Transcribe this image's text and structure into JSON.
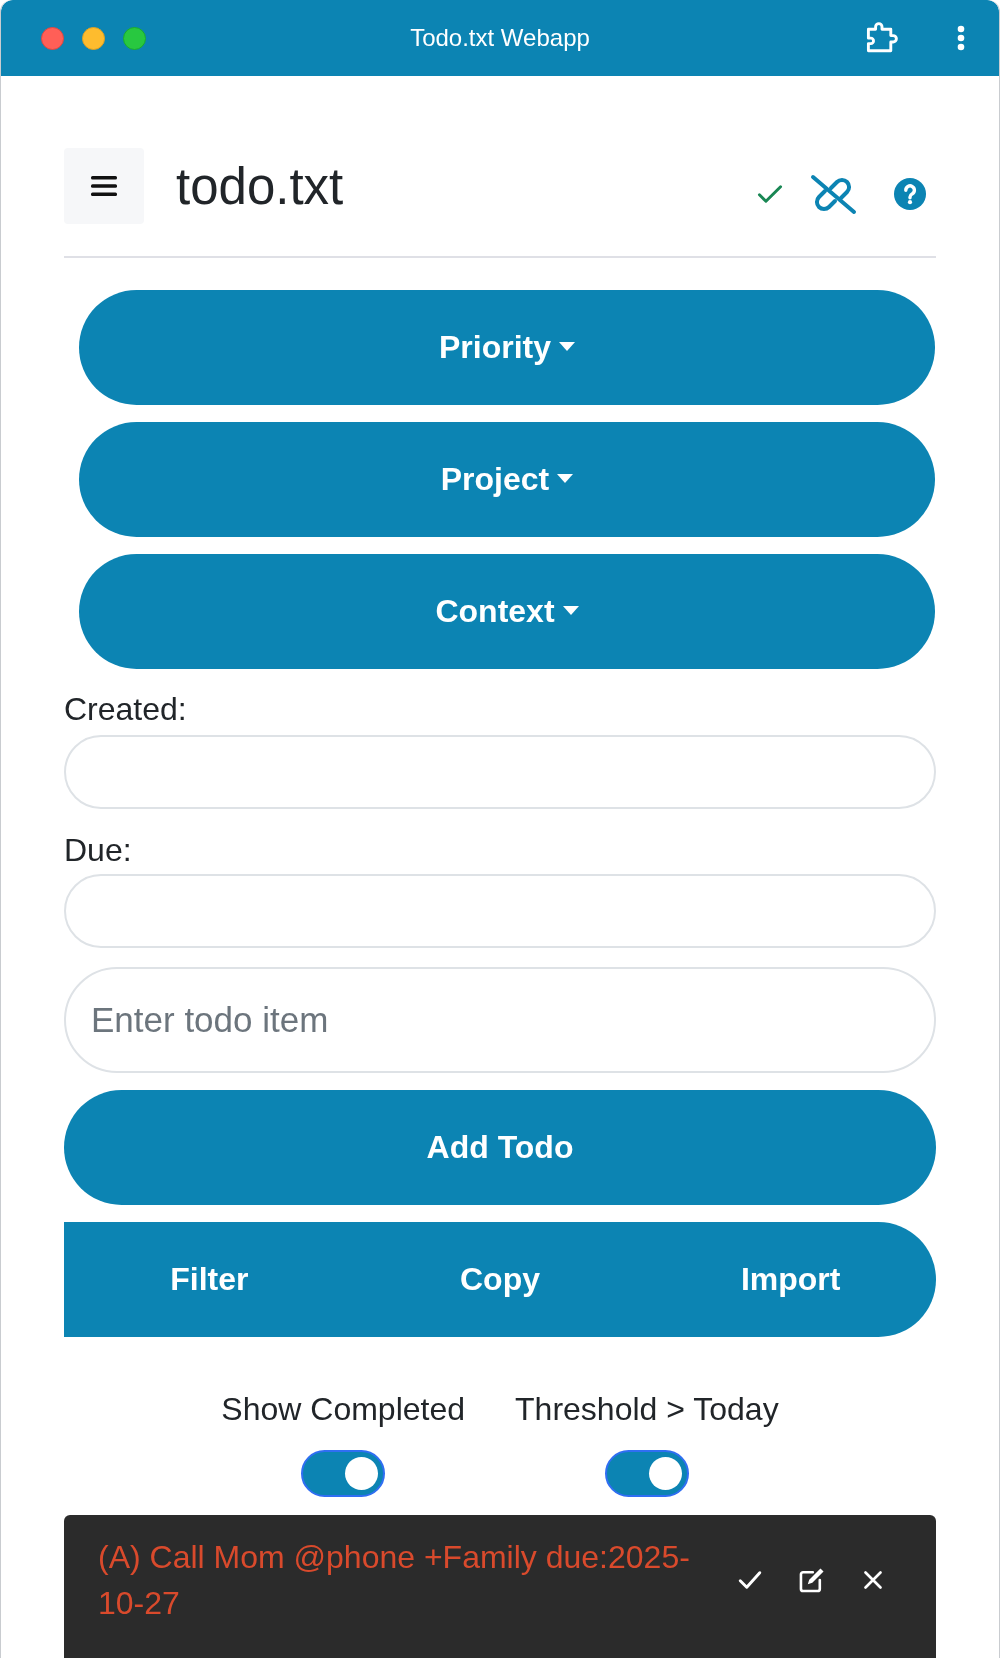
{
  "window": {
    "title": "Todo.txt Webapp"
  },
  "header": {
    "title": "todo.txt"
  },
  "dropdowns": [
    {
      "label": "Priority"
    },
    {
      "label": "Project"
    },
    {
      "label": "Context"
    }
  ],
  "date_fields": [
    {
      "label": "Created:"
    },
    {
      "label": "Due:"
    }
  ],
  "todo_input": {
    "placeholder": "Enter todo item"
  },
  "add_button": {
    "label": "Add Todo"
  },
  "actions": [
    {
      "label": "Filter"
    },
    {
      "label": "Copy"
    },
    {
      "label": "Import"
    }
  ],
  "toggles": [
    {
      "label": "Show Completed",
      "checked": true
    },
    {
      "label": "Threshold > Today",
      "checked": true
    }
  ],
  "todos": [
    {
      "text": "(A) Call Mom @phone +Family due:2025-10-27",
      "color": "#d94a2c"
    }
  ]
}
